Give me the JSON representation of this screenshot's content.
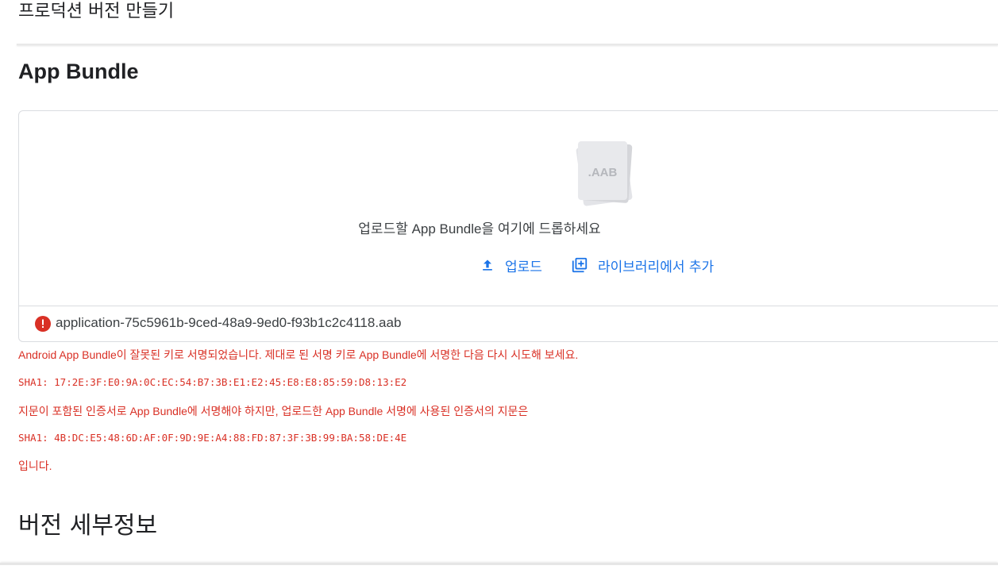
{
  "page": {
    "title": "프로덕션 버전 만들기"
  },
  "app_bundle": {
    "heading": "App Bundle",
    "placeholder_label": ".AAB",
    "drop_hint": "업로드할 App Bundle을 여기에 드롭하세요",
    "upload_label": "업로드",
    "library_label": "라이브러리에서 추가",
    "file_name": "application-75c5961b-9ced-48a9-9ed0-f93b1c2c4118.aab"
  },
  "error": {
    "line1": "Android App Bundle이 잘못된 키로 서명되었습니다. 제대로 된 서명 키로 App Bundle에 서명한 다음 다시 시도해 보세요.",
    "sha_expected": "SHA1: 17:2E:3F:E0:9A:0C:EC:54:B7:3B:E1:E2:45:E8:E8:85:59:D8:13:E2",
    "line2": "지문이 포함된 인증서로 App Bundle에 서명해야 하지만, 업로드한 App Bundle 서명에 사용된 인증서의 지문은",
    "sha_actual": "SHA1: 4B:DC:E5:48:6D:AF:0F:9D:9E:A4:88:FD:87:3F:3B:99:BA:58:DE:4E",
    "line3": "입니다."
  },
  "version_details": {
    "heading": "버전 세부정보"
  },
  "colors": {
    "link": "#1a73e8",
    "error": "#d93025",
    "text": "#202124"
  },
  "icons": {
    "placeholder": "aab-file-icon",
    "upload": "upload-icon",
    "library": "library-add-icon",
    "file_error": "error-icon"
  }
}
